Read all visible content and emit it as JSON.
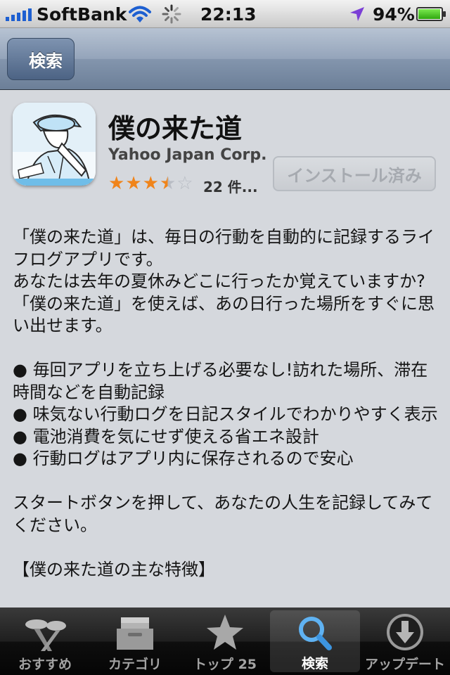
{
  "status_bar": {
    "carrier": "SoftBank",
    "time": "22:13",
    "battery_percent": "94%",
    "battery_level": 0.94,
    "signal_icon": "signal-bars-icon",
    "wifi_icon": "wifi-icon",
    "activity_icon": "activity-spinner-icon",
    "location_icon": "location-arrow-icon"
  },
  "nav": {
    "back_label": "検索"
  },
  "app": {
    "name": "僕の来た道",
    "developer": "Yahoo Japan Corp.",
    "rating_value": 3.5,
    "rating_max": 5,
    "rating_count": "22 件...",
    "install_label": "インストール済み",
    "icon_name": "app-icon-illustration"
  },
  "description": {
    "intro": "「僕の来た道」は、毎日の行動を自動的に記録するライフログアプリです。",
    "question": "あなたは去年の夏休みどこに行ったか覚えていますか?「僕の来た道」を使えば、あの日行った場所をすぐに思い出せます。",
    "bullets": [
      "● 毎回アプリを立ち上げる必要なし!訪れた場所、滞在時間などを自動記録",
      "● 味気ない行動ログを日記スタイルでわかりやすく表示",
      "● 電池消費を気にせず使える省エネ設計",
      "● 行動ログはアプリ内に保存されるので安心"
    ],
    "cta": "スタートボタンを押して、あなたの人生を記録してみてください。",
    "features_heading": "【僕の来た道の主な特徴】"
  },
  "tabs": [
    {
      "label": "おすすめ",
      "icon": "featured-icon",
      "active": false
    },
    {
      "label": "カテゴリ",
      "icon": "categories-icon",
      "active": false
    },
    {
      "label": "トップ 25",
      "icon": "top25-star-icon",
      "active": false
    },
    {
      "label": "検索",
      "icon": "search-icon",
      "active": true
    },
    {
      "label": "アップデート",
      "icon": "updates-icon",
      "active": false
    }
  ],
  "colors": {
    "star": "#f0841a",
    "nav_bar": "#8395ad",
    "tab_active_icon": "#5fb2f2"
  }
}
